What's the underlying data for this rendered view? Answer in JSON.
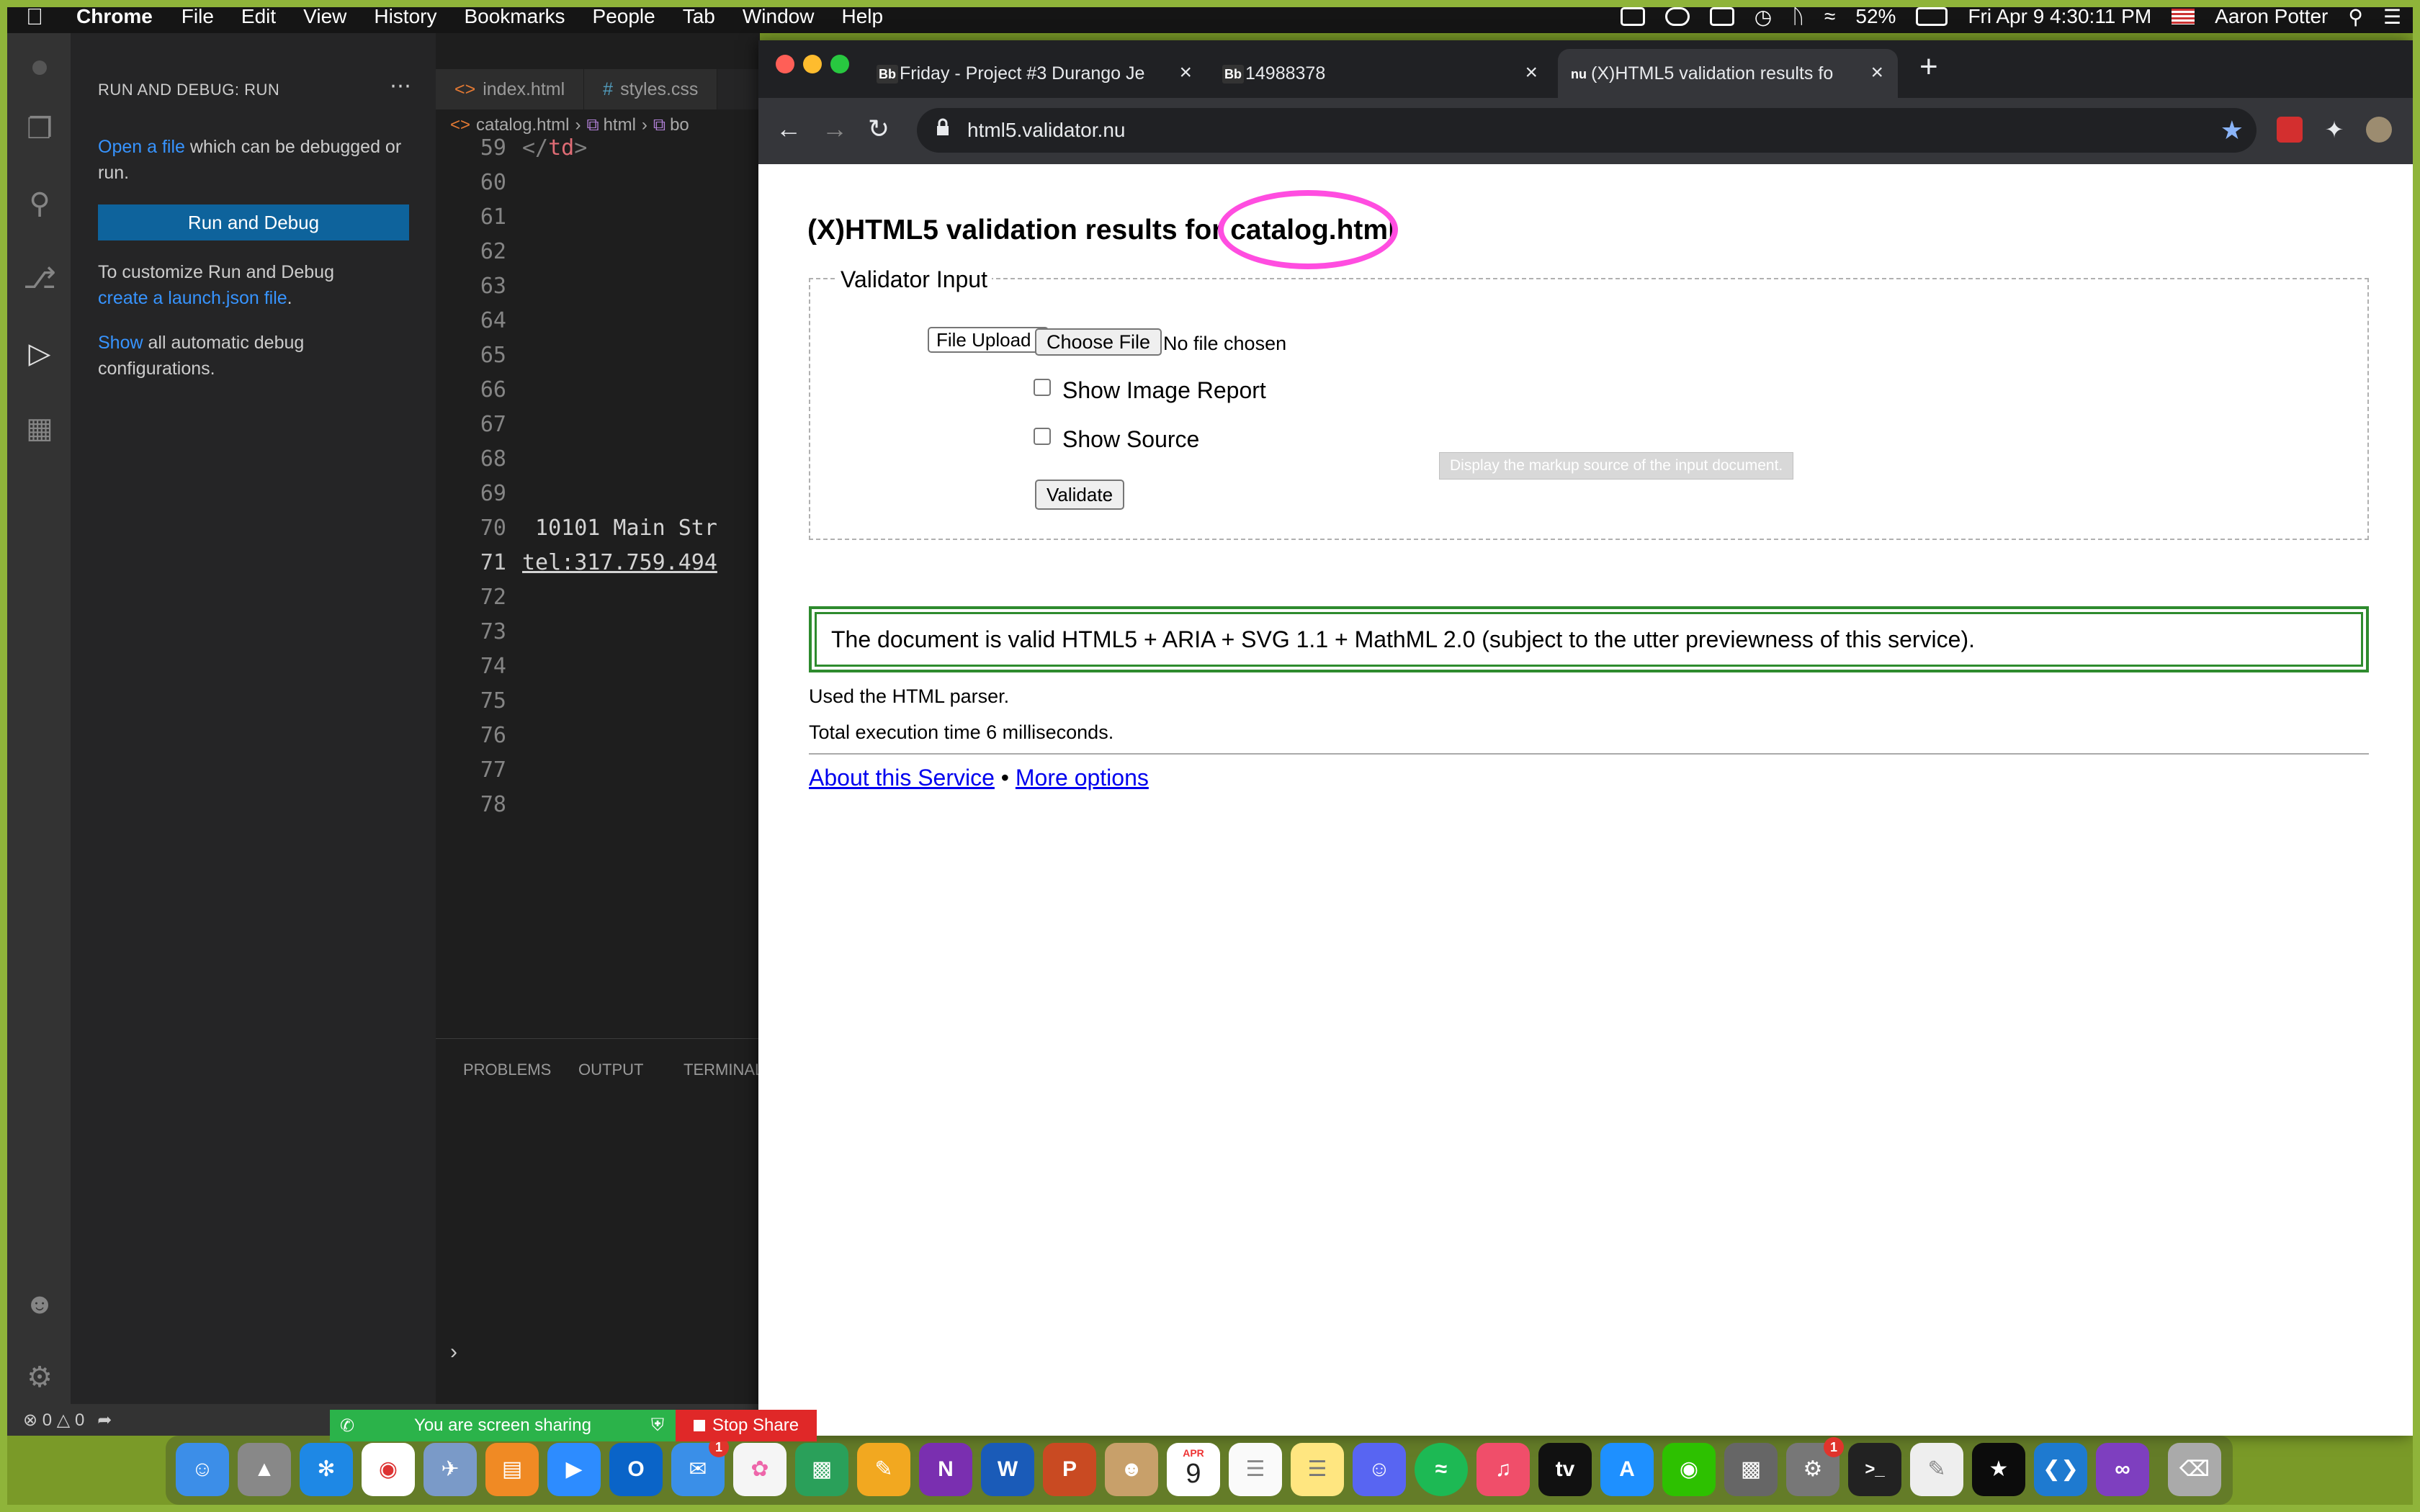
{
  "menubar": {
    "app_name": "Chrome",
    "menus": [
      "File",
      "Edit",
      "View",
      "History",
      "Bookmarks",
      "People",
      "Tab",
      "Window",
      "Help"
    ],
    "battery": "52%",
    "datetime": "Fri Apr 9  4:30:11 PM",
    "user": "Aaron Potter"
  },
  "vscode": {
    "sidebar": {
      "title": "RUN AND DEBUG: RUN",
      "open_link": "Open a file",
      "open_rest": " which can be debugged or run.",
      "run_button": "Run and Debug",
      "customize_text": "To customize Run and Debug",
      "launch_link": "create a launch.json file",
      "launch_rest": ".",
      "show_link": "Show",
      "show_rest": " all automatic debug configurations."
    },
    "tabs": [
      "index.html",
      "styles.css"
    ],
    "breadcrumb": [
      "catalog.html",
      "html",
      "bo"
    ],
    "lines": [
      {
        "num": "59",
        "code": "</td>"
      },
      {
        "num": "60",
        "code": ""
      },
      {
        "num": "61",
        "code": ""
      },
      {
        "num": "62",
        "code": ""
      },
      {
        "num": "63",
        "code": ""
      },
      {
        "num": "64",
        "code": ""
      },
      {
        "num": "65",
        "code": ""
      },
      {
        "num": "66",
        "code": ""
      },
      {
        "num": "67",
        "code": ""
      },
      {
        "num": "68",
        "code": ""
      },
      {
        "num": "69",
        "code": ""
      },
      {
        "num": "70",
        "code": " 10101 Main Str"
      },
      {
        "num": "71",
        "code": "tel:317.759.494"
      },
      {
        "num": "72",
        "code": ""
      },
      {
        "num": "73",
        "code": ""
      },
      {
        "num": "74",
        "code": ""
      },
      {
        "num": "75",
        "code": ""
      },
      {
        "num": "76",
        "code": ""
      },
      {
        "num": "77",
        "code": ""
      },
      {
        "num": "78",
        "code": ""
      }
    ],
    "panel_tabs": [
      "PROBLEMS",
      "OUTPUT",
      "TERMINAL"
    ],
    "status": {
      "errors": "0",
      "warnings": "0"
    }
  },
  "chrome": {
    "tabs": [
      {
        "favicon": "Bb",
        "title": "Friday - Project #3 Durango Je"
      },
      {
        "favicon": "Bb",
        "title": "14988378"
      },
      {
        "favicon": "nu",
        "title": "(X)HTML5 validation results fo"
      }
    ],
    "url": "html5.validator.nu"
  },
  "page": {
    "heading_prefix": "(X)HTML5 validation results for ",
    "heading_file": "catalog.html",
    "legend": "Validator Input",
    "select_value": "File Upload",
    "choose_file": "Choose File",
    "no_file": "No file chosen",
    "show_image_report": "Show Image Report",
    "show_source": "Show Source",
    "tooltip": "Display the markup source of the input document.",
    "validate": "Validate",
    "result": "The document is valid HTML5 + ARIA + SVG 1.1 + MathML 2.0 (subject to the utter previewness of this service).",
    "parser_info": "Used the HTML parser.",
    "time_info": "Total execution time 6 milliseconds.",
    "about_link": "About this Service",
    "separator": " • ",
    "more_link": "More options"
  },
  "zoom": {
    "sharing": "You are screen sharing",
    "stop": "Stop Share"
  },
  "dock": {
    "calendar_month": "APR",
    "calendar_day": "9",
    "messages_badge": "1",
    "settings_badge": "1"
  },
  "colors": {
    "highlight_circle": "#ff4de0",
    "valid_border": "#2e8b2e",
    "vscode_button": "#0e639c"
  }
}
